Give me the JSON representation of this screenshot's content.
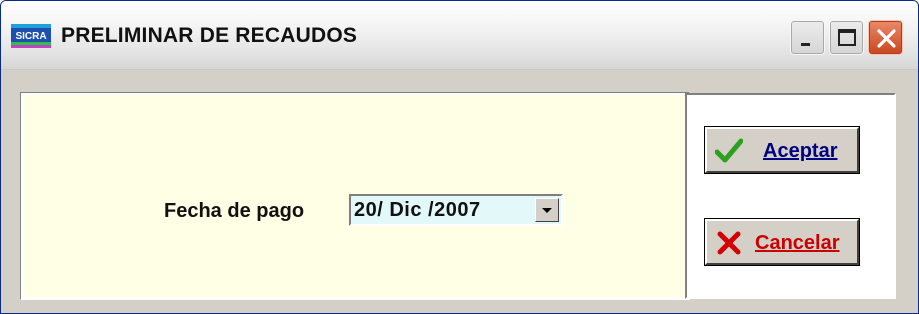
{
  "window": {
    "title": "PRELIMINAR DE RECAUDOS",
    "app_icon": "sicra-app-icon"
  },
  "title_buttons": {
    "minimize_icon": "minimize-icon",
    "maximize_icon": "maximize-icon",
    "close_icon": "close-icon"
  },
  "form": {
    "fecha_label": "Fecha de pago",
    "fecha_value": "20/ Dic /2007",
    "dropdown_icon": "chevron-down-icon"
  },
  "actions": {
    "accept_label": "Aceptar",
    "accept_icon": "checkmark-icon",
    "cancel_label": "Cancelar",
    "cancel_icon": "x-mark-icon"
  },
  "colors": {
    "left_panel_bg": "#ffffe6",
    "date_field_bg": "#e3f8f8",
    "accept_text": "#000080",
    "cancel_text": "#cc0000",
    "checkmark": "#2ea020",
    "xmark": "#d40000"
  }
}
